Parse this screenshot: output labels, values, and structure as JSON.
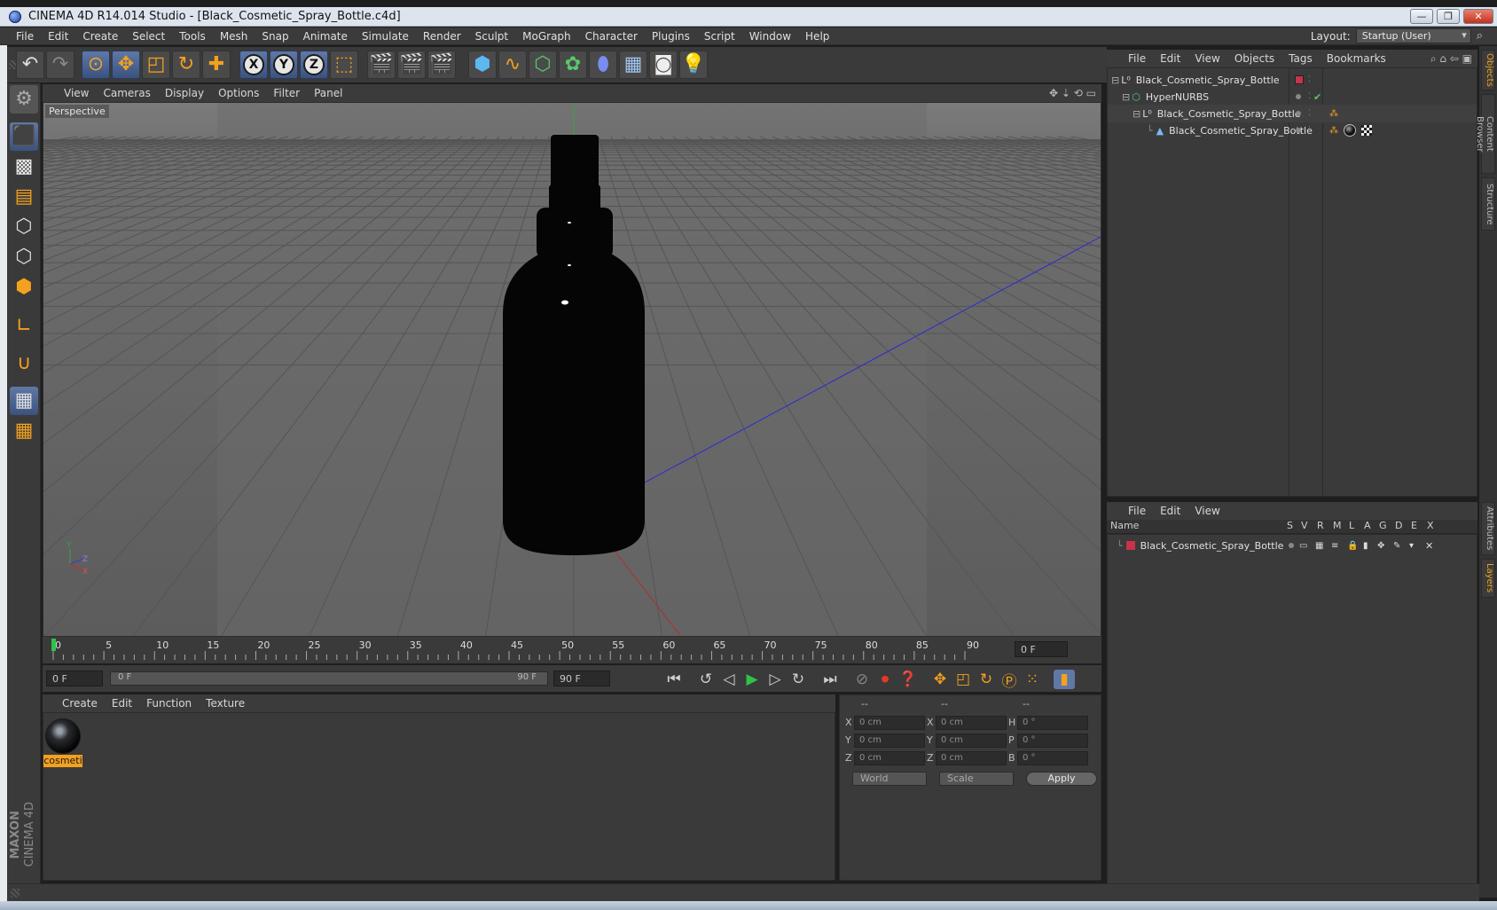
{
  "window": {
    "title": "CINEMA 4D R14.014 Studio - [Black_Cosmetic_Spray_Bottle.c4d]",
    "minimize_label": "—",
    "restore_label": "❐",
    "close_label": "✕"
  },
  "menubar": {
    "items": [
      "File",
      "Edit",
      "Create",
      "Select",
      "Tools",
      "Mesh",
      "Snap",
      "Animate",
      "Simulate",
      "Render",
      "Sculpt",
      "MoGraph",
      "Character",
      "Plugins",
      "Script",
      "Window",
      "Help"
    ],
    "layout_label": "Layout:",
    "layout_value": "Startup (User)"
  },
  "viewport": {
    "menu": [
      "View",
      "Cameras",
      "Display",
      "Options",
      "Filter",
      "Panel"
    ],
    "label": "Perspective",
    "axis_y": "Y",
    "axis_z": "Z",
    "axis_x": "X"
  },
  "timeline": {
    "ticks": [
      "0",
      "5",
      "10",
      "15",
      "20",
      "25",
      "30",
      "35",
      "40",
      "45",
      "50",
      "55",
      "60",
      "65",
      "70",
      "75",
      "80",
      "85",
      "90"
    ],
    "current_frame": "0 F",
    "start_field": "0 F",
    "range_start": "0 F",
    "range_end": "90 F",
    "end_field": "90 F"
  },
  "material_manager": {
    "menu": [
      "Create",
      "Edit",
      "Function",
      "Texture"
    ],
    "materials": [
      {
        "name": "cosmeti"
      }
    ]
  },
  "coordinates": {
    "headers": [
      "--",
      "--",
      "--"
    ],
    "rows": [
      {
        "a": "X",
        "av": "0 cm",
        "b": "X",
        "bv": "0 cm",
        "c": "H",
        "cv": "0 °"
      },
      {
        "a": "Y",
        "av": "0 cm",
        "b": "Y",
        "bv": "0 cm",
        "c": "P",
        "cv": "0 °"
      },
      {
        "a": "Z",
        "av": "0 cm",
        "b": "Z",
        "bv": "0 cm",
        "c": "B",
        "cv": "0 °"
      }
    ],
    "world_label": "World",
    "scale_label": "Scale",
    "apply_label": "Apply"
  },
  "object_manager": {
    "menu": [
      "File",
      "Edit",
      "View",
      "Objects",
      "Tags",
      "Bookmarks"
    ],
    "objects": [
      {
        "name": "Black_Cosmetic_Spray_Bottle",
        "level": 0
      },
      {
        "name": "HyperNURBS",
        "level": 1
      },
      {
        "name": "Black_Cosmetic_Spray_Bottle",
        "level": 2
      },
      {
        "name": "Black_Cosmetic_Spray_Bottle",
        "level": 3
      }
    ]
  },
  "layer_manager": {
    "menu": [
      "File",
      "Edit",
      "View"
    ],
    "columns": [
      "Name",
      "S",
      "V",
      "R",
      "M",
      "L",
      "A",
      "G",
      "D",
      "E",
      "X"
    ],
    "layers": [
      {
        "name": "Black_Cosmetic_Spray_Bottle",
        "color": "#c8324a"
      }
    ]
  },
  "right_tabs": [
    "Objects",
    "Content Browser",
    "Structure",
    "Attributes",
    "Layers"
  ],
  "branding": {
    "maxon": "MAXON",
    "product": "CINEMA 4D"
  },
  "colors": {
    "accent": "#f3a11f",
    "selection_blue": "#5f78a6",
    "layer_red": "#c8324a"
  }
}
